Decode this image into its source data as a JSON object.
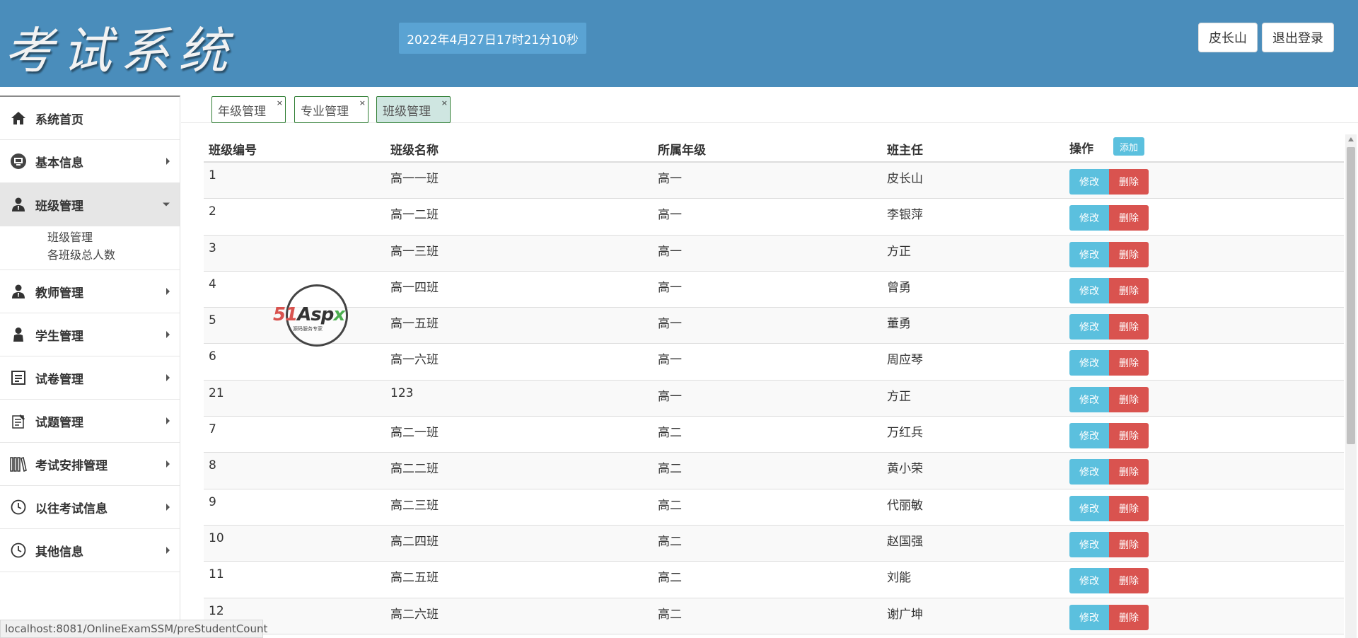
{
  "header": {
    "logo": "考试系统",
    "datetime": "2022年4月27日17时21分10秒",
    "user_label": "皮长山",
    "logout_label": "退出登录"
  },
  "sidebar": {
    "items": [
      {
        "label": "系统首页",
        "icon": "home-icon"
      },
      {
        "label": "基本信息",
        "icon": "monitor-icon"
      },
      {
        "label": "班级管理",
        "icon": "user-icon"
      },
      {
        "label": "教师管理",
        "icon": "user-icon"
      },
      {
        "label": "学生管理",
        "icon": "person-icon"
      },
      {
        "label": "试卷管理",
        "icon": "document-icon"
      },
      {
        "label": "试题管理",
        "icon": "notepad-icon"
      },
      {
        "label": "考试安排管理",
        "icon": "books-icon"
      },
      {
        "label": "以往考试信息",
        "icon": "clock-icon"
      },
      {
        "label": "其他信息",
        "icon": "clock-icon"
      }
    ],
    "sub_items": [
      "班级管理",
      "各班级总人数"
    ]
  },
  "tabs": [
    {
      "label": "年级管理",
      "close": "×"
    },
    {
      "label": "专业管理",
      "close": "×"
    },
    {
      "label": "班级管理",
      "close": "×"
    }
  ],
  "table": {
    "headers": [
      "班级编号",
      "班级名称",
      "所属年级",
      "班主任",
      "操作"
    ],
    "add_label": "添加",
    "edit_label": "修改",
    "delete_label": "删除",
    "rows": [
      [
        "1",
        "高一一班",
        "高一",
        "皮长山"
      ],
      [
        "2",
        "高一二班",
        "高一",
        "李银萍"
      ],
      [
        "3",
        "高一三班",
        "高一",
        "方正"
      ],
      [
        "4",
        "高一四班",
        "高一",
        "曾勇"
      ],
      [
        "5",
        "高一五班",
        "高一",
        "董勇"
      ],
      [
        "6",
        "高一六班",
        "高一",
        "周应琴"
      ],
      [
        "21",
        "123",
        "高一",
        "方正"
      ],
      [
        "7",
        "高二一班",
        "高二",
        "万红兵"
      ],
      [
        "8",
        "高二二班",
        "高二",
        "黄小荣"
      ],
      [
        "9",
        "高二三班",
        "高二",
        "代丽敏"
      ],
      [
        "10",
        "高二四班",
        "高二",
        "赵国强"
      ],
      [
        "11",
        "高二五班",
        "高二",
        "刘能"
      ],
      [
        "12",
        "高二六班",
        "高二",
        "谢广坤"
      ]
    ]
  },
  "watermark": {
    "part1": "51",
    "part2": "Asp",
    "part3": "x",
    "sub": "源码服务专家"
  },
  "statusbar": {
    "url": "localhost:8081/OnlineExamSSM/preStudentCount"
  },
  "colors": {
    "header_bg": "#4a8dbb",
    "datetime_bg": "#5aa3d3",
    "edit": "#5bc0de",
    "delete": "#d9534f",
    "tab_border": "#2e7d32"
  }
}
